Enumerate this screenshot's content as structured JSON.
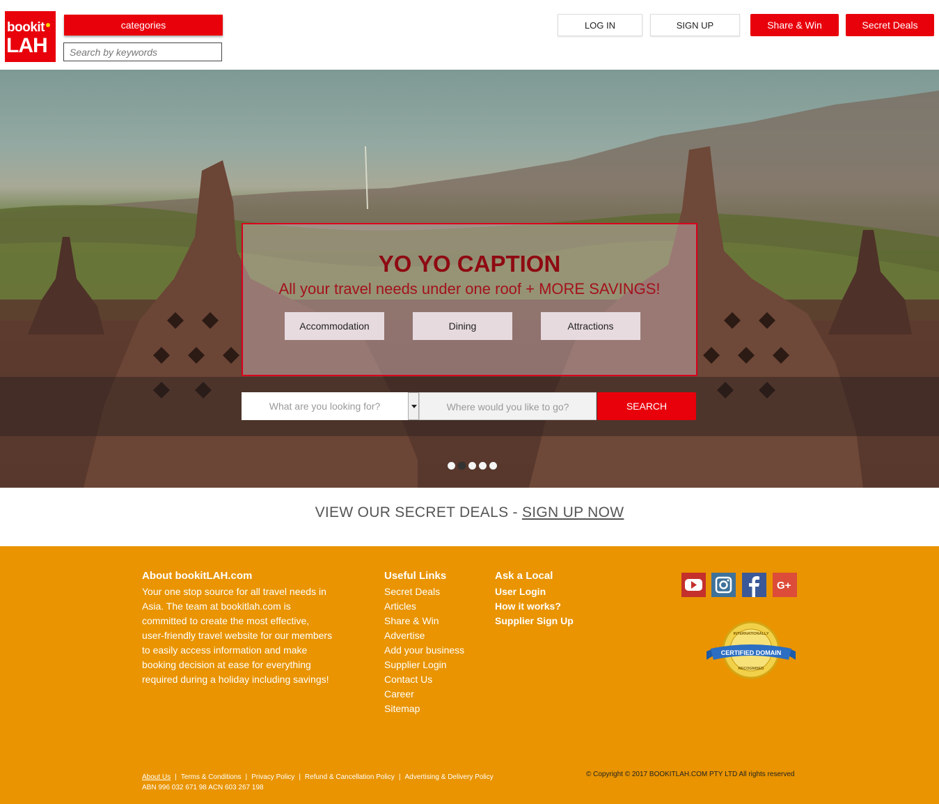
{
  "header": {
    "logo_line1": "bookit",
    "logo_line2": "LAH",
    "categories_label": "categories",
    "search_placeholder": "Search by keywords",
    "login_label": "LOG IN",
    "signup_label": "SIGN UP",
    "share_win_label": "Share & Win",
    "secret_deals_label": "Secret Deals"
  },
  "hero": {
    "caption_title": "YO YO CAPTION",
    "caption_subtitle": "All your travel needs under one roof + MORE SAVINGS!",
    "category_buttons": [
      "Accommodation",
      "Dining",
      "Attractions"
    ],
    "what_placeholder": "What are you looking for?",
    "where_placeholder": "Where would you like to go?",
    "search_label": "SEARCH",
    "slides_count": 5,
    "active_slide": 2
  },
  "deals_strip": {
    "text": "VIEW OUR SECRET DEALS - ",
    "link": "SIGN UP NOW"
  },
  "footer": {
    "about": {
      "title": "About bookitLAH.com",
      "text": "Your one stop source for all travel needs in Asia. The team at bookitlah.com is committed to create the most effective, user-friendly travel website for our members to easily access information and make booking decision at ease for everything required during a holiday including savings!"
    },
    "useful_links": {
      "title": "Useful Links",
      "items": [
        "Secret Deals",
        "Articles",
        "Share & Win",
        "Advertise",
        "Add your business",
        "Supplier Login",
        "Contact Us",
        "Career",
        "Sitemap"
      ]
    },
    "ask_local": {
      "title": "Ask a Local",
      "items": [
        "User Login",
        "How it works?",
        "Supplier Sign Up"
      ]
    },
    "seal_text_top": "INTERNATIONALLY",
    "seal_text_main": "CERTIFIED DOMAIN",
    "seal_text_bottom": "RECOGNISED",
    "bottom_links": [
      "About Us",
      "Terms & Conditions",
      "Privacy Policy",
      "Refund & Cancellation Policy",
      "Advertising & Delivery Policy"
    ],
    "abn": "ABN 996 032 671 98 ACN 603 267 198",
    "copyright": "© Copyright © 2017 BOOKITLAH.COM PTY LTD All rights reserved"
  },
  "colors": {
    "brand_red": "#e8000b",
    "footer_orange": "#e99400",
    "caption_red": "#8e0a12"
  }
}
